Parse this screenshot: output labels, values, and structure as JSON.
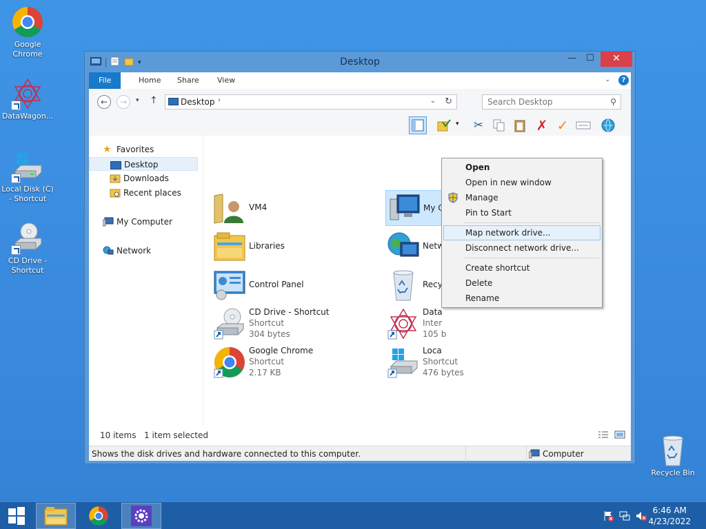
{
  "desktop": {
    "icons": [
      {
        "label": "Google Chrome"
      },
      {
        "label": "DataWagon..."
      },
      {
        "label": "Local Disk (C) - Shortcut"
      },
      {
        "label": "CD Drive - Shortcut"
      },
      {
        "label": "Recycle Bin"
      }
    ]
  },
  "window": {
    "title": "Desktop",
    "tabs": [
      "File",
      "Home",
      "Share",
      "View"
    ],
    "address": "Desktop",
    "search_placeholder": "Search Desktop"
  },
  "nav": {
    "favorites": "Favorites",
    "desktop": "Desktop",
    "downloads": "Downloads",
    "recent": "Recent places",
    "computer": "My Computer",
    "network": "Network"
  },
  "files": [
    {
      "name": "VM4"
    },
    {
      "name": "Libraries"
    },
    {
      "name": "Control Panel"
    },
    {
      "name": "CD Drive - Shortcut",
      "type": "Shortcut",
      "size": "304 bytes"
    },
    {
      "name": "Google Chrome",
      "type": "Shortcut",
      "size": "2.17 KB"
    },
    {
      "name": "My Computer"
    },
    {
      "name": "Netw"
    },
    {
      "name": "Recy"
    },
    {
      "name": "Data",
      "type": "Inter",
      "size": "105 b"
    },
    {
      "name": "Loca",
      "type": "Shortcut",
      "size": "476 bytes"
    }
  ],
  "status": {
    "items": "10 items",
    "selected": "1 item selected",
    "description": "Shows the disk drives and hardware connected to this computer.",
    "location": "Computer"
  },
  "context_menu": {
    "items": [
      "Open",
      "Open in new window",
      "Manage",
      "Pin to Start",
      "Map network drive...",
      "Disconnect network drive...",
      "Create shortcut",
      "Delete",
      "Rename"
    ]
  },
  "taskbar": {
    "time": "6:46 AM",
    "date": "4/23/2022"
  }
}
